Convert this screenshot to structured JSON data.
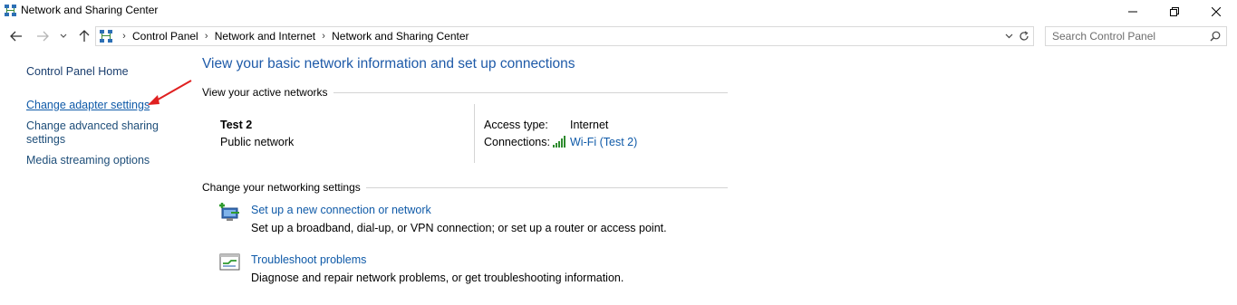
{
  "window": {
    "title": "Network and Sharing Center",
    "icon": "network-center-icon",
    "controls": [
      "minimize-icon",
      "maximize-icon",
      "close-icon"
    ]
  },
  "nav": {
    "back_icon": "arrow-left-icon",
    "forward_icon": "arrow-right-icon",
    "recent_icon": "chevron-down-icon",
    "up_icon": "arrow-up-icon"
  },
  "breadcrumb": [
    "Control Panel",
    "Network and Internet",
    "Network and Sharing Center"
  ],
  "search": {
    "placeholder": "Search Control Panel"
  },
  "sidebar": {
    "home": "Control Panel Home",
    "items": [
      "Change adapter settings",
      "Change advanced sharing settings",
      "Media streaming options"
    ]
  },
  "annotation": {
    "arrow_color": "#e02020"
  },
  "main": {
    "title": "View your basic network information and set up connections",
    "active_header": "View your active networks",
    "network": {
      "name": "Test 2",
      "type": "Public network",
      "access_label": "Access type:",
      "access_value": "Internet",
      "connections_label": "Connections:",
      "connections_value": "Wi-Fi (Test 2)"
    },
    "change_header": "Change your networking settings",
    "tasks": [
      {
        "link": "Set up a new connection or network",
        "desc": "Set up a broadband, dial-up, or VPN connection; or set up a router or access point."
      },
      {
        "link": "Troubleshoot problems",
        "desc": "Diagnose and repair network problems, or get troubleshooting information."
      }
    ]
  },
  "colors": {
    "link": "#0f5aa8",
    "title": "#1e5aa8",
    "divider": "#d4d4d4"
  }
}
